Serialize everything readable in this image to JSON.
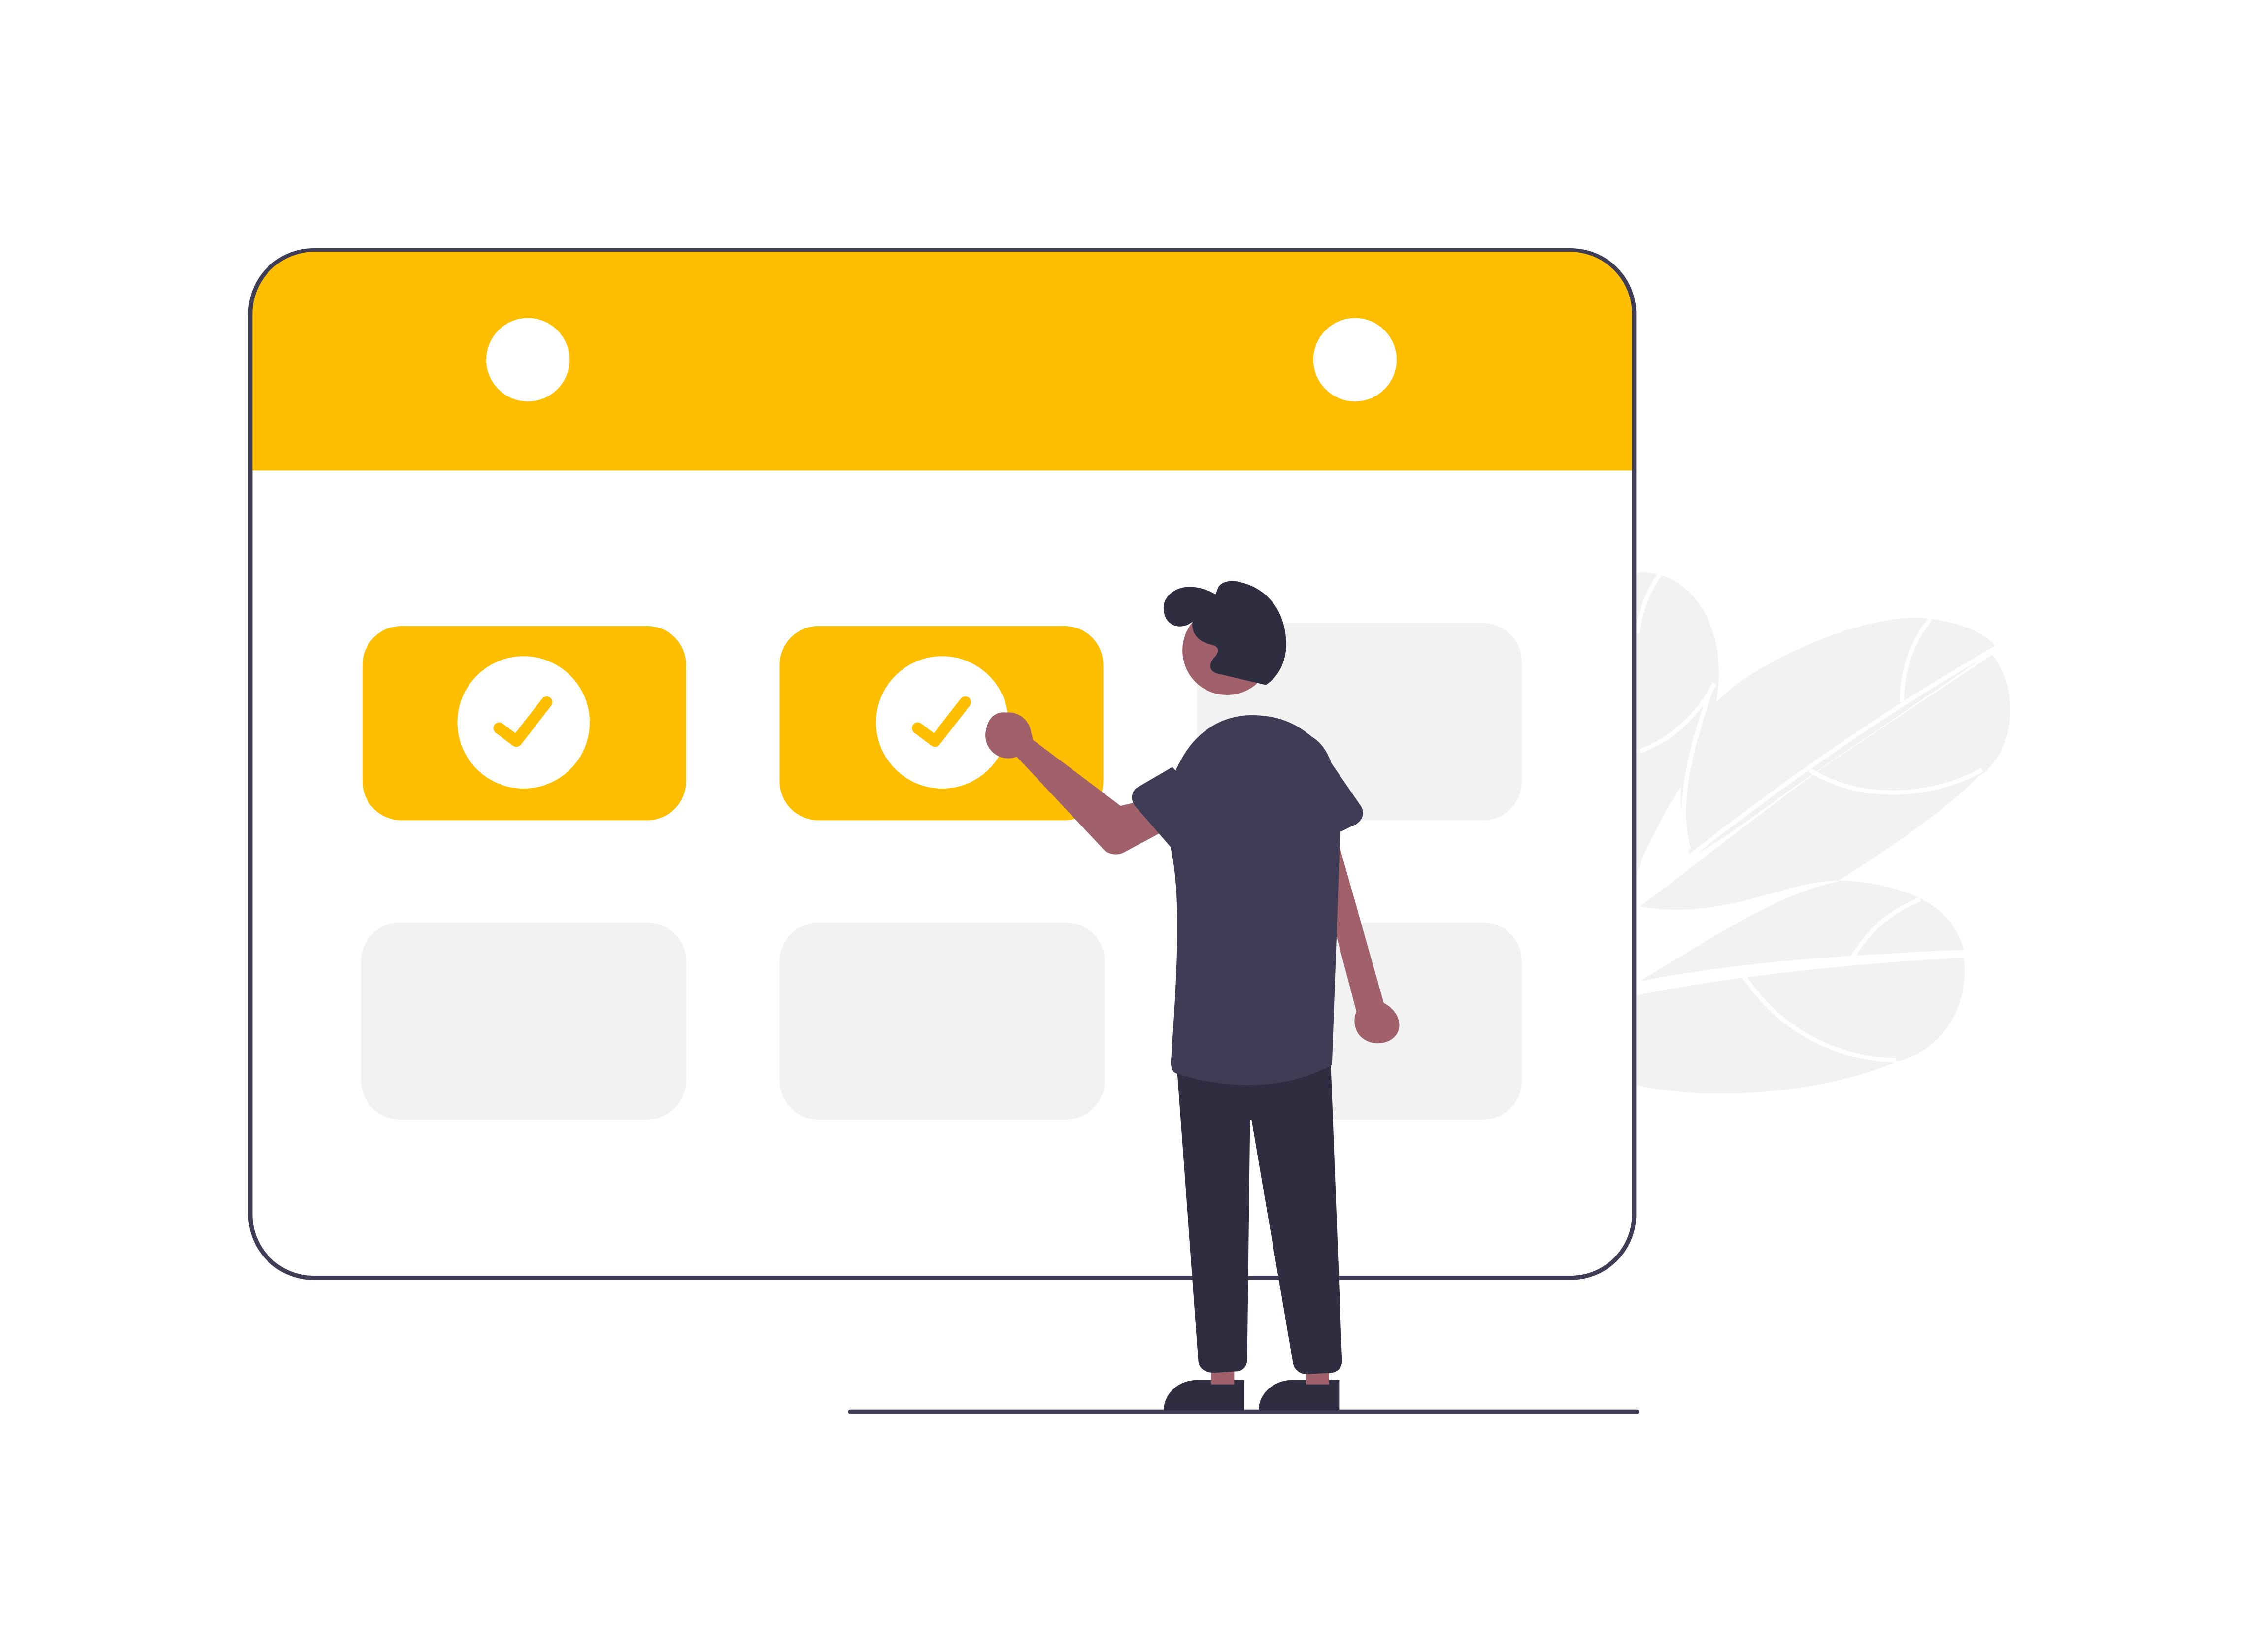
{
  "colors": {
    "background": "#ffffff",
    "accent": "#ffbf00",
    "outline": "#3f3d56",
    "empty_slot": "#f2f2f2",
    "plant": "#f2f2f2",
    "skin": "#a0616a",
    "hair": "#2f2e41",
    "shirt": "#3f3d56",
    "pants": "#2f2e41",
    "white": "#ffffff"
  },
  "icons": {
    "calendar": "calendar-icon",
    "checkmark": "check-icon",
    "binder_ring": "ring-hole-icon"
  },
  "calendar": {
    "columns": 3,
    "rows": 2,
    "completed_slots": 2,
    "total_slots": 6
  }
}
